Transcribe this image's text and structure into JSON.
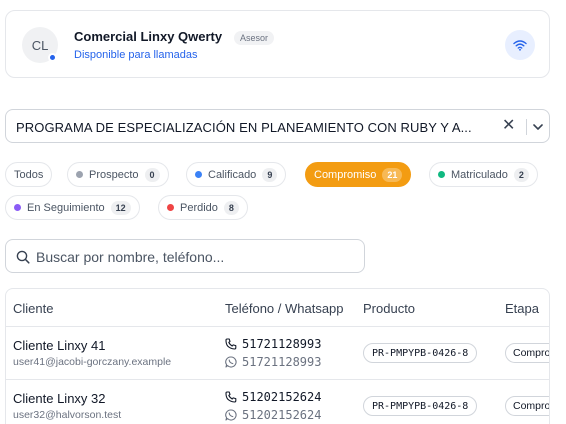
{
  "agent": {
    "initials": "CL",
    "name": "Comercial Linxy Qwerty",
    "role": "Asesor",
    "status": "Disponible para llamadas"
  },
  "program_select": {
    "value": "PROGRAMA DE ESPECIALIZACIÓN EN PLANEAMIENTO CON RUBY Y A..."
  },
  "filters": [
    {
      "label": "Todos",
      "count": "",
      "color": "",
      "active": false
    },
    {
      "label": "Prospecto",
      "count": "0",
      "color": "#9ca3af",
      "active": false
    },
    {
      "label": "Calificado",
      "count": "9",
      "color": "#3b82f6",
      "active": false
    },
    {
      "label": "Compromiso",
      "count": "21",
      "color": "",
      "active": true
    },
    {
      "label": "Matriculado",
      "count": "2",
      "color": "#10b981",
      "active": false
    },
    {
      "label": "En Seguimiento",
      "count": "12",
      "color": "#8b5cf6",
      "active": false
    },
    {
      "label": "Perdido",
      "count": "8",
      "color": "#ef4444",
      "active": false
    }
  ],
  "search": {
    "placeholder": "Buscar por nombre, teléfono..."
  },
  "table": {
    "headers": {
      "client": "Cliente",
      "phone": "Teléfono / Whatsapp",
      "product": "Producto",
      "stage": "Etapa"
    },
    "rows": [
      {
        "name": "Cliente Linxy 41",
        "email": "user41@jacobi-gorczany.example",
        "phone": "51721128993",
        "whatsapp": "51721128993",
        "product": "PR-PMPYPB-0426-8",
        "stage": "Compromiso"
      },
      {
        "name": "Cliente Linxy 32",
        "email": "user32@halvorson.test",
        "phone": "51202152624",
        "whatsapp": "51202152624",
        "product": "PR-PMPYPB-0426-8",
        "stage": "Compromiso"
      }
    ]
  },
  "colors": {
    "accent": "#f39c12",
    "link": "#2563eb",
    "online_dot": "#2563eb"
  }
}
